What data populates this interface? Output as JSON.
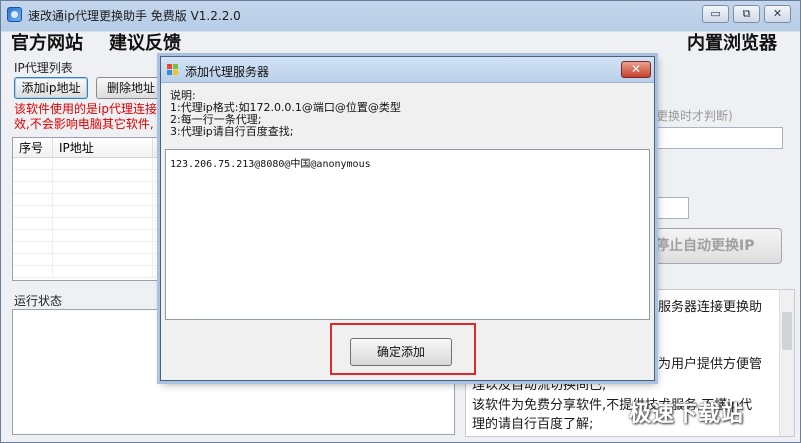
{
  "window": {
    "title": "速改通ip代理更换助手 免费版 V1.2.2.0",
    "controls": {
      "minimize": "▭",
      "maximize": "⧉",
      "close": "✕"
    }
  },
  "menu": {
    "official_site": "官方网站",
    "feedback": "建议反馈",
    "builtin_browser": "内置浏览器"
  },
  "ip_panel": {
    "group_title": "IP代理列表",
    "add_button": "添加ip地址",
    "delete_button": "删除地址",
    "warning_lines": [
      "该软件使用的是ip代理连接",
      "效,不会影响电脑其它软件,"
    ],
    "columns": [
      "序号",
      "IP地址"
    ]
  },
  "status_panel": {
    "group_title": "运行状态"
  },
  "right_panel": {
    "hint": "更换时才判断)",
    "stop_button": "停止自动更换IP",
    "info_lines": [
      "服务器连接更换助",
      "为用户提供方便管",
      "理以及自动流切换间已;",
      "该软件为免费分享软件,不提供技术服务,不懂ip代",
      "理的请自行百度了解;"
    ]
  },
  "watermark": "极速下载站",
  "dialog": {
    "title": "添加代理服务器",
    "close_label": "✕",
    "description": [
      "说明:",
      "1:代理ip格式:如172.0.0.1@端口@位置@类型",
      "2:每一行一条代理;",
      "3:代理ip请自行百度查找;"
    ],
    "proxy_text": "123.206.75.213@8080@中国@anonymous",
    "confirm_button": "确定添加"
  },
  "colors": {
    "highlight": "#e0282d",
    "warning_text": "#e00000",
    "dialog_close": "#c7412b"
  }
}
